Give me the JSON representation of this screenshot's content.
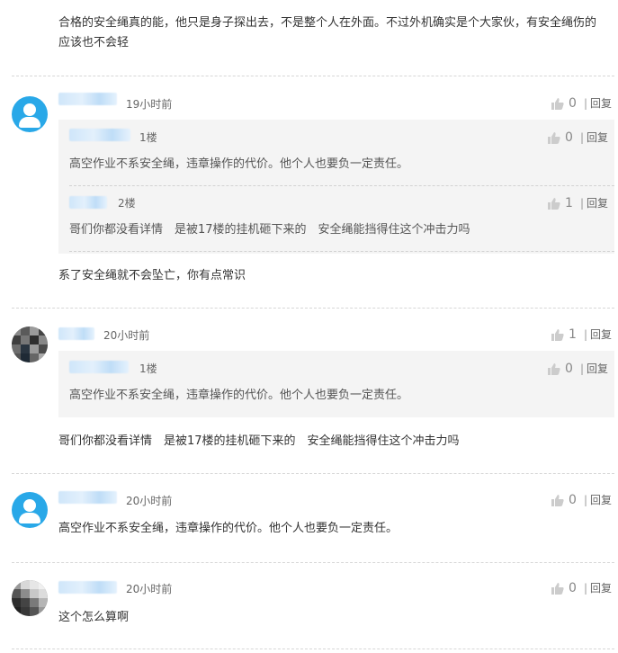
{
  "comments": [
    {
      "text": "合格的安全绳真的能，他只是身子探出去，不是整个人在外面。不过外机确实是个大家伙，有安全绳伤的应该也不会轻"
    },
    {
      "time": "19小时前",
      "likes": "0",
      "reply": "回复",
      "quotes": [
        {
          "floor": "1楼",
          "likes": "0",
          "reply": "回复",
          "text": "高空作业不系安全绳，违章操作的代价。他个人也要负一定责任。"
        },
        {
          "floor": "2楼",
          "likes": "1",
          "reply": "回复",
          "text": "哥们你都没看详情　是被17楼的挂机砸下来的　安全绳能挡得住这个冲击力吗"
        }
      ],
      "text": "系了安全绳就不会坠亡，你有点常识"
    },
    {
      "time": "20小时前",
      "likes": "1",
      "reply": "回复",
      "quotes": [
        {
          "floor": "1楼",
          "likes": "0",
          "reply": "回复",
          "text": "高空作业不系安全绳，违章操作的代价。他个人也要负一定责任。"
        }
      ],
      "text": "哥们你都没看详情　是被17楼的挂机砸下来的　安全绳能挡得住这个冲击力吗"
    },
    {
      "time": "20小时前",
      "likes": "0",
      "reply": "回复",
      "text": "高空作业不系安全绳，违章操作的代价。他个人也要负一定责任。"
    },
    {
      "time": "20小时前",
      "likes": "0",
      "reply": "回复",
      "text": "这个怎么算啊"
    }
  ],
  "colors": {
    "accent": "#29a8e8",
    "quote_bg": "#f4f4f4"
  },
  "icons": {
    "like": "thumbs-up-icon",
    "avatar_default": "user-avatar-icon"
  }
}
